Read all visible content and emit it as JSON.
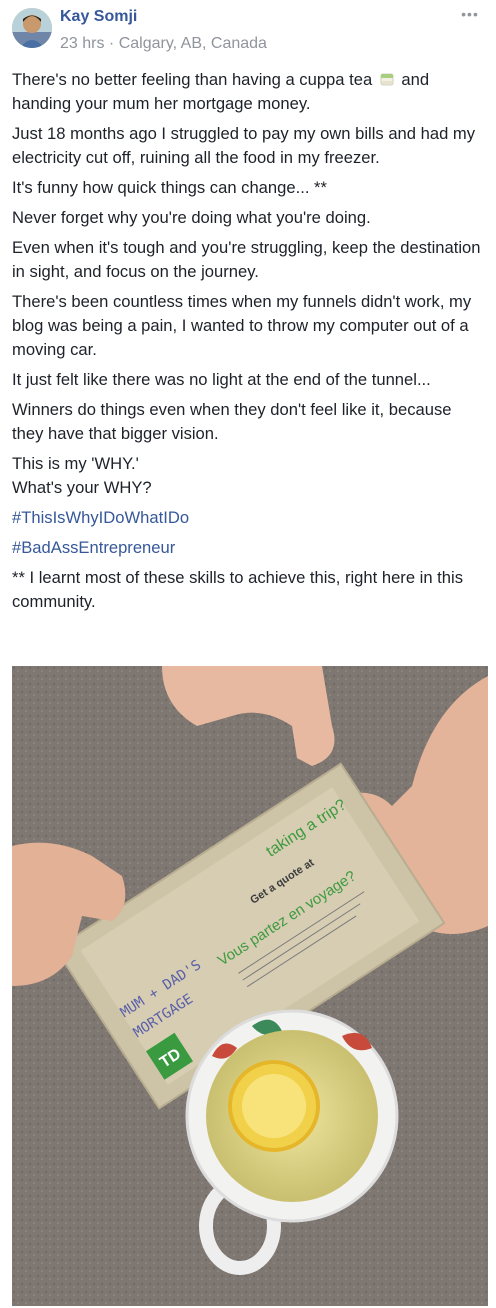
{
  "post": {
    "author": "Kay Somji",
    "time": "23 hrs",
    "separator": "·",
    "location": "Calgary, AB, Canada",
    "more_icon": "more-options-icon",
    "paragraphs": {
      "p1a": "There's no better feeling than having a cuppa tea ",
      "p1b": " and handing your mum her mortgage money.",
      "p2": "Just 18 months ago I struggled to pay my own bills and had my electricity cut off, ruining all the food in my freezer.",
      "p3": "It's funny how quick things can change... **",
      "p4": "Never forget why you're doing what you're doing.",
      "p5": "Even when it's tough and you're struggling, keep the destination in sight, and focus on the journey.",
      "p6": "There's been countless times when my funnels didn't work, my blog was being a pain, I wanted to throw my computer out of a moving car.",
      "p7": "It just felt like there was no light at the end of the tunnel...",
      "p8": "Winners do things even when they don't feel like it, because they have that bigger vision.",
      "p9": "This is my 'WHY.'",
      "p10": "What's your WHY?",
      "hashtag1": "#ThisIsWhyIDoWhatIDo",
      "hashtag2": "#BadAssEntrepreneur",
      "p11": "** I learnt most of these skills to achieve this, right here in this community."
    },
    "photo": {
      "envelope_text": {
        "line1": "taking a trip?",
        "line2": "Get a quote at",
        "line3": "Vous partez en voyage?",
        "handwriting1": "MUM + DAD'S",
        "handwriting2": "MORTGAGE",
        "logo": "TD"
      }
    },
    "colors": {
      "link": "#365899",
      "meta": "#90949c",
      "text": "#1d2129",
      "td_green": "#2e8b3a"
    }
  }
}
